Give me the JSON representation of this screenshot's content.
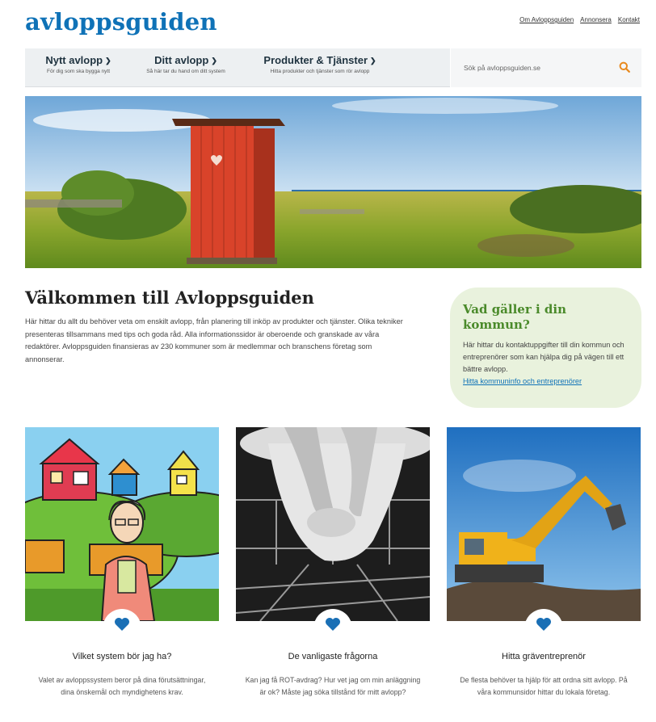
{
  "header": {
    "logo": "avloppsguiden",
    "links": [
      "Om Avloppsguiden",
      "Annonsera",
      "Kontakt"
    ]
  },
  "nav": {
    "items": [
      {
        "title": "Nytt avlopp",
        "sub": "För dig som ska bygga nytt"
      },
      {
        "title": "Ditt avlopp",
        "sub": "Så här tar du hand om ditt system"
      },
      {
        "title": "Produkter & Tjänster",
        "sub": "Hitta produkter och tjänster som rör avlopp"
      }
    ],
    "search_placeholder": "Sök på avloppsguiden.se"
  },
  "welcome": {
    "title": "Välkommen till Avloppsguiden",
    "text": "Här hittar du allt du behöver veta om enskilt avlopp, från planering till inköp av produkter och tjänster. Olika tekniker presenteras tillsammans med tips och goda råd. Alla informationssidor är oberoende och granskade av våra redaktörer. Avloppsguiden finansieras av 230 kommuner som är medlemmar och branschens företag som annonserar."
  },
  "kommun": {
    "title": "Vad gäller i din kommun?",
    "text": "Här hittar du kontaktuppgifter till din kommun och entreprenörer som kan hjälpa dig på vägen till ett bättre avlopp.",
    "link": "Hitta kommuninfo och entreprenörer"
  },
  "cards": [
    {
      "title": "Vilket system bör jag ha?",
      "text": "Valet av avloppssystem beror på dina förutsättningar, dina önskemål och myndighetens krav."
    },
    {
      "title": "De vanligaste frågorna",
      "text": "Kan jag få ROT-avdrag? Hur vet jag om min anläggning är ok? Måste jag söka tillstånd för mitt avlopp?"
    },
    {
      "title": "Hitta gräventreprenör",
      "text": "De flesta behöver ta hjälp för att ordna sitt avlopp. På våra kommunsidor hittar du lokala företag."
    }
  ],
  "colors": {
    "brand_blue": "#0f72b7",
    "heart_blue": "#1a6fb5",
    "search_orange": "#e8891d",
    "kommun_green": "#4a8a2a",
    "kommun_bg": "#e9f2dd"
  }
}
